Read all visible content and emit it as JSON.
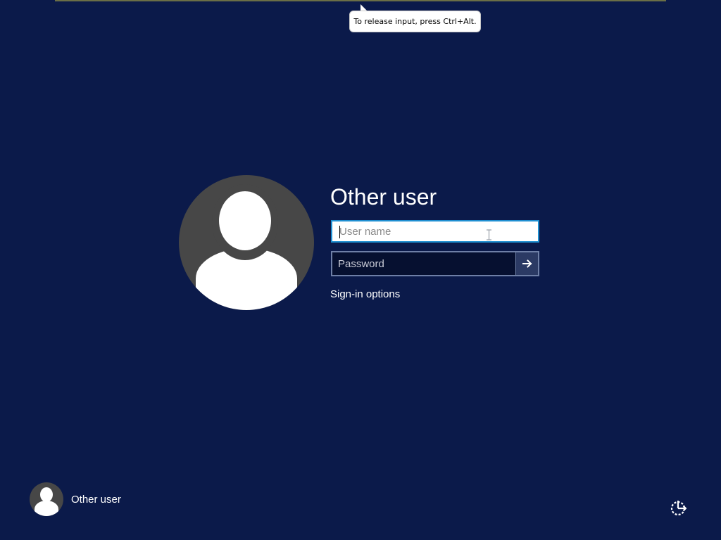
{
  "tooltip": {
    "text": "To release input, press Ctrl+Alt."
  },
  "login": {
    "title": "Other user",
    "username": {
      "placeholder": "User name",
      "value": ""
    },
    "password": {
      "placeholder": "Password",
      "value": ""
    },
    "submit_icon": "arrow-right-icon",
    "sign_in_options_label": "Sign-in options"
  },
  "user_list": [
    {
      "label": "Other user",
      "icon": "user-avatar-icon"
    }
  ],
  "corner": {
    "ease_of_access_icon": "ease-of-access-icon"
  },
  "colors": {
    "background": "#0b1a4a",
    "avatar": "#474747",
    "focus_border": "#1f8fd1",
    "password_bg": "#061030",
    "submit_bg": "#2b3a64"
  }
}
